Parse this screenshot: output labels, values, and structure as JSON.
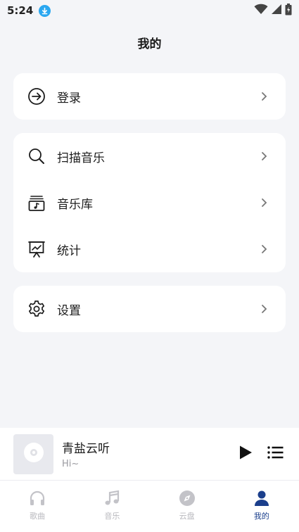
{
  "status_bar": {
    "time": "5:24"
  },
  "page": {
    "title": "我的"
  },
  "account_card": {
    "items": [
      {
        "label": "登录",
        "icon": "login-icon"
      }
    ]
  },
  "library_card": {
    "items": [
      {
        "label": "扫描音乐",
        "icon": "search-icon"
      },
      {
        "label": "音乐库",
        "icon": "music-library-icon"
      },
      {
        "label": "统计",
        "icon": "statistics-icon"
      }
    ]
  },
  "settings_card": {
    "items": [
      {
        "label": "设置",
        "icon": "gear-icon"
      }
    ]
  },
  "player": {
    "title": "青盐云听",
    "subtitle": "Hi~"
  },
  "bottom_nav": {
    "items": [
      {
        "label": "歌曲",
        "icon": "headphones-icon"
      },
      {
        "label": "音乐",
        "icon": "music-note-icon"
      },
      {
        "label": "云盘",
        "icon": "compass-icon"
      },
      {
        "label": "我的",
        "icon": "person-icon",
        "active": true
      }
    ]
  },
  "colors": {
    "accent": "#1b3f8c",
    "inactive": "#b9b9be",
    "background": "#f4f5f8",
    "download_badge": "#2aa7f0"
  }
}
